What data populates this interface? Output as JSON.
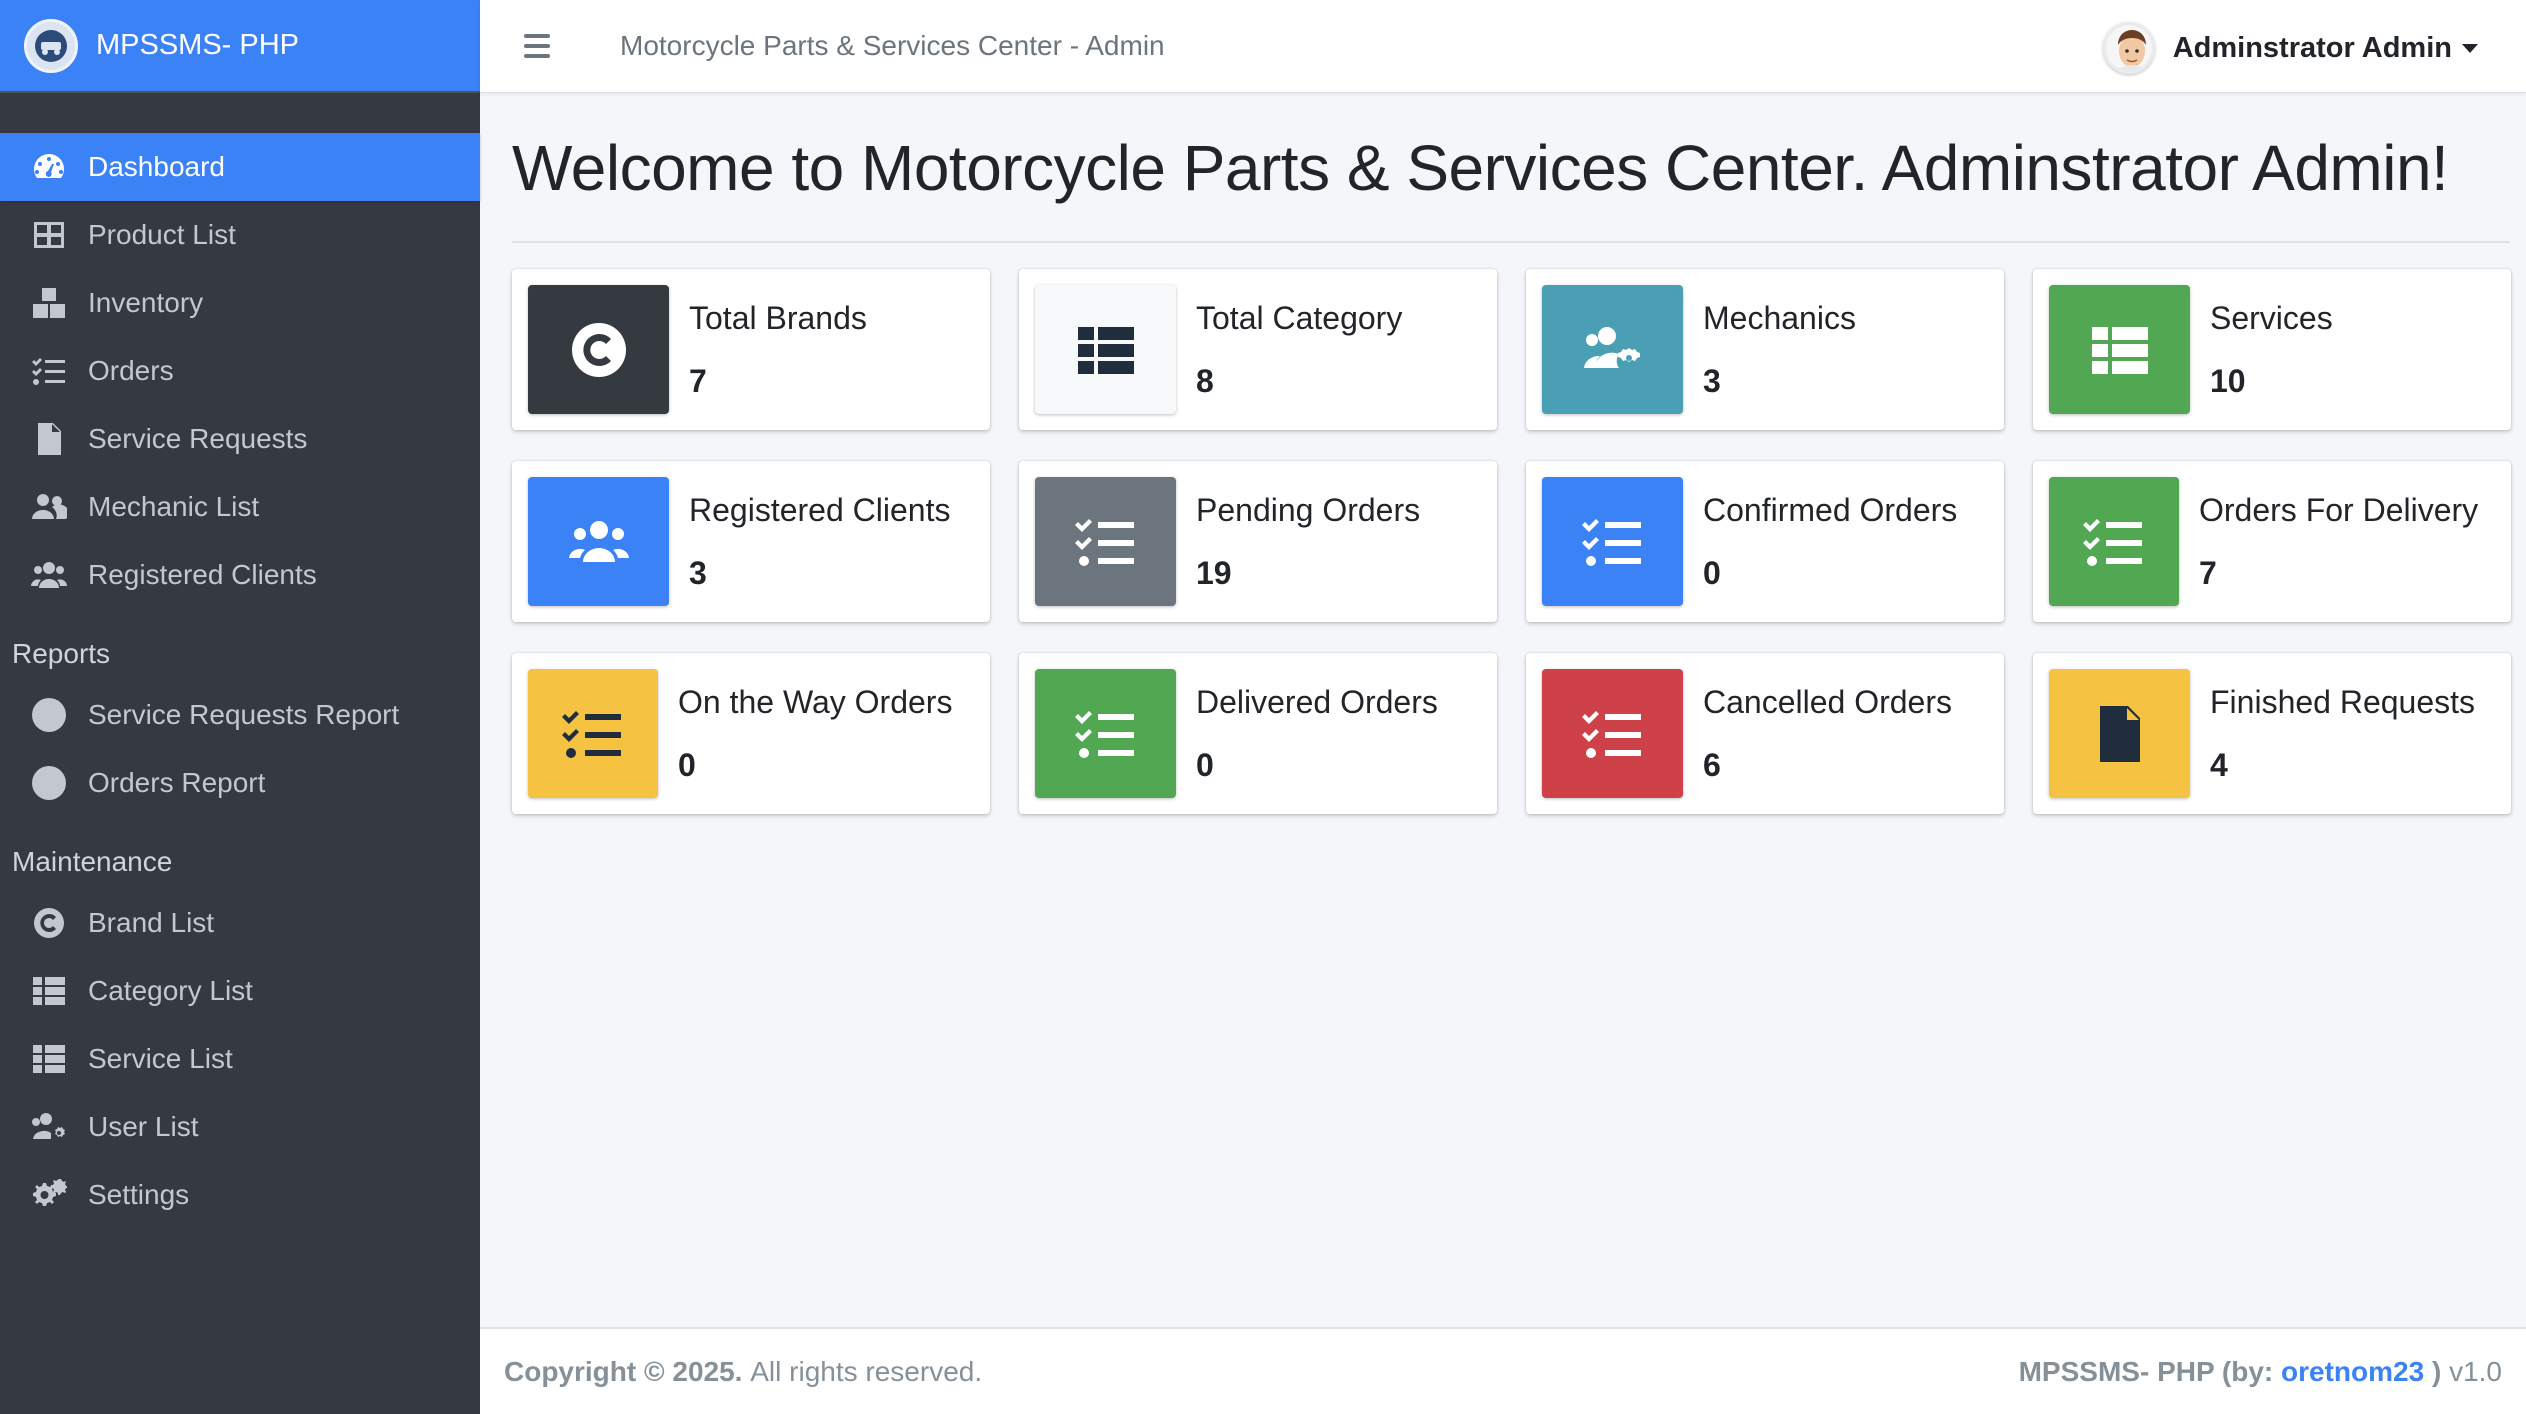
{
  "brand": {
    "name": "MPSSMS- PHP"
  },
  "header": {
    "title": "Motorcycle Parts & Services Center - Admin",
    "user_name": "Adminstrator Admin"
  },
  "sidebar": {
    "items": [
      {
        "label": "Dashboard"
      },
      {
        "label": "Product List"
      },
      {
        "label": "Inventory"
      },
      {
        "label": "Orders"
      },
      {
        "label": "Service Requests"
      },
      {
        "label": "Mechanic List"
      },
      {
        "label": "Registered Clients"
      }
    ],
    "reports_header": "Reports",
    "reports": [
      {
        "label": "Service Requests Report"
      },
      {
        "label": "Orders Report"
      }
    ],
    "maintenance_header": "Maintenance",
    "maintenance": [
      {
        "label": "Brand List"
      },
      {
        "label": "Category List"
      },
      {
        "label": "Service List"
      },
      {
        "label": "User List"
      },
      {
        "label": "Settings"
      }
    ]
  },
  "main": {
    "welcome": "Welcome to Motorcycle Parts & Services Center. Adminstrator Admin!",
    "cards": [
      {
        "label": "Total Brands",
        "value": "7",
        "color": "#343a40",
        "icon": "copyright-icon"
      },
      {
        "label": "Total Category",
        "value": "8",
        "color": "#f8f9fa",
        "icon": "th-list-icon"
      },
      {
        "label": "Mechanics",
        "value": "3",
        "color": "#4a9fb4",
        "icon": "users-cog-icon"
      },
      {
        "label": "Services",
        "value": "10",
        "color": "#52a852",
        "icon": "th-list-icon"
      },
      {
        "label": "Registered Clients",
        "value": "3",
        "color": "#3b82f6",
        "icon": "users-icon"
      },
      {
        "label": "Pending Orders",
        "value": "19",
        "color": "#6c757d",
        "icon": "tasks-icon"
      },
      {
        "label": "Confirmed Orders",
        "value": "0",
        "color": "#3b82f6",
        "icon": "tasks-icon"
      },
      {
        "label": "Orders For Delivery",
        "value": "7",
        "color": "#52a852",
        "icon": "tasks-icon"
      },
      {
        "label": "On the Way Orders",
        "value": "0",
        "color": "#f5c242",
        "icon": "tasks-icon"
      },
      {
        "label": "Delivered Orders",
        "value": "0",
        "color": "#52a852",
        "icon": "tasks-icon"
      },
      {
        "label": "Cancelled Orders",
        "value": "6",
        "color": "#cf4148",
        "icon": "tasks-icon"
      },
      {
        "label": "Finished Requests",
        "value": "4",
        "color": "#f5c242",
        "icon": "file-alt-icon"
      }
    ]
  },
  "footer": {
    "copyright": "Copyright © 2025.",
    "rights": "All rights reserved.",
    "app": "MPSSMS- PHP (by:",
    "author": "oretnom23",
    "close": ")",
    "version": "v1.0"
  }
}
